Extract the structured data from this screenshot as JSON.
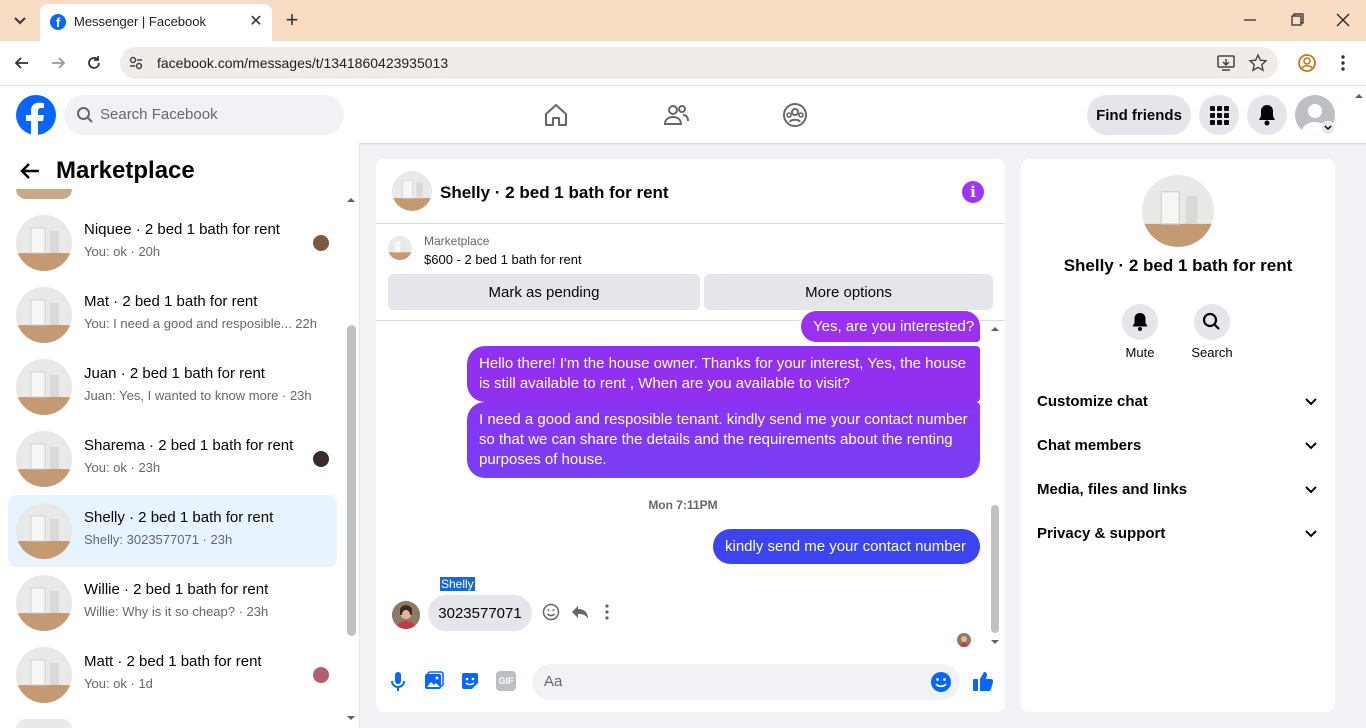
{
  "browser": {
    "tab_title": "Messenger | Facebook",
    "url": "facebook.com/messages/t/1341860423935013"
  },
  "header": {
    "search_placeholder": "Search Facebook",
    "find_friends": "Find friends"
  },
  "left": {
    "title": "Marketplace",
    "conversations": [
      {
        "name": "Niquee · 2 bed 1 bath for rent",
        "preview": "You: ok · 20h"
      },
      {
        "name": "Mat · 2 bed 1 bath for rent",
        "preview": "You: I need a good and resposible...  22h"
      },
      {
        "name": "Juan · 2 bed 1 bath for rent",
        "preview": "Juan: Yes, I wanted to know more · 23h"
      },
      {
        "name": "Sharema · 2 bed 1 bath for rent",
        "preview": "You: ok · 23h"
      },
      {
        "name": "Shelly · 2 bed 1 bath for rent",
        "preview": "Shelly: 3023577071 · 23h"
      },
      {
        "name": "Willie · 2 bed 1 bath for rent",
        "preview": "Willie: Why is it so cheap? · 23h"
      },
      {
        "name": "Matt · 2 bed 1 bath for rent",
        "preview": "You: ok · 1d"
      }
    ]
  },
  "chat": {
    "title": "Shelly · 2 bed 1 bath for rent",
    "listing_source": "Marketplace",
    "listing_title": "$600 - 2 bed 1 bath for rent",
    "mark_pending": "Mark as pending",
    "more_options": "More options",
    "messages": [
      "Yes, are you interested?",
      "Hello there! I'm the house owner. Thanks for your interest, Yes, the house is still available to rent , When are you available to visit?",
      "I need a good and resposible tenant.  kindly send me your contact number so that we can share the details and the requirements about the renting purposes of house.",
      "kindly send me your contact number"
    ],
    "timestamp": "Mon 7:11PM",
    "sender_name": "Shelly",
    "received_message": "3023577071",
    "composer_placeholder": "Aa"
  },
  "right": {
    "title": "Shelly · 2 bed 1 bath for rent",
    "mute": "Mute",
    "search": "Search",
    "sections": [
      "Customize chat",
      "Chat members",
      "Media, files and links",
      "Privacy & support"
    ]
  },
  "colors": {
    "accent": "#7b3ef5",
    "fb_blue": "#0866ff",
    "selected_row": "#e7f3ff",
    "tabbar": "#f9dcc4"
  }
}
